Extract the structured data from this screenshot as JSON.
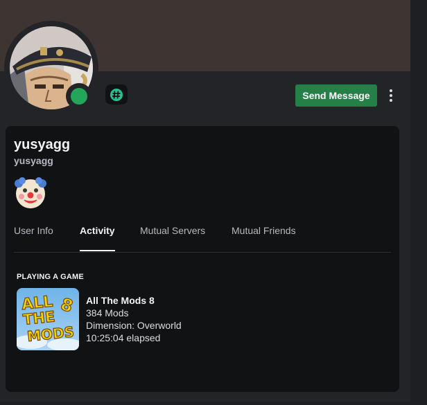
{
  "profile": {
    "display_name": "yusyagg",
    "username": "yusyagg",
    "status": "online",
    "status_color": "#23a55a",
    "banner_color": "#3e3532",
    "emoji_status": "clown-face"
  },
  "badge": {
    "icon": "hashtag-badge-icon"
  },
  "actions": {
    "send_message": "Send Message",
    "more": "more-options-icon"
  },
  "tabs": [
    {
      "label": "User Info",
      "active": false
    },
    {
      "label": "Activity",
      "active": true
    },
    {
      "label": "Mutual Servers",
      "active": false
    },
    {
      "label": "Mutual Friends",
      "active": false
    }
  ],
  "activity": {
    "section_label": "PLAYING A GAME",
    "game": {
      "title": "All The Mods 8",
      "art_text": [
        "ALL",
        "THE",
        "MODS",
        "8"
      ],
      "details": "384 Mods",
      "state": "Dimension: Overworld",
      "elapsed": "10:25:04 elapsed"
    }
  },
  "colors": {
    "accent_button": "#248046",
    "panel": "#111214",
    "card": "#232428"
  }
}
